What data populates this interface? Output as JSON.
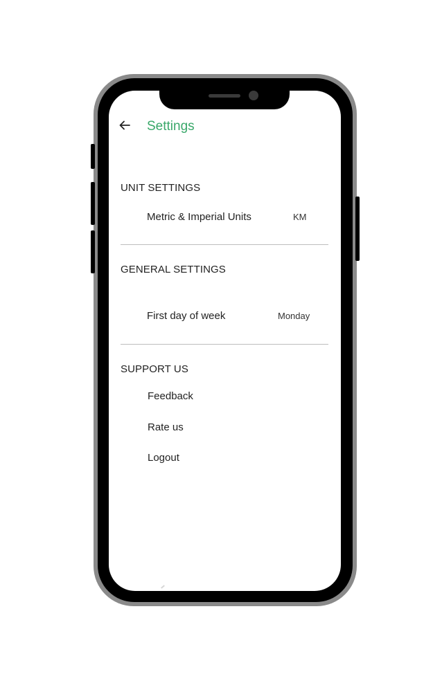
{
  "header": {
    "back_icon": "arrow-left-icon",
    "title": "Settings",
    "title_color": "#3aa86a"
  },
  "sections": {
    "unit": {
      "title": "UNIT SETTINGS",
      "rows": [
        {
          "label": "Metric & Imperial Units",
          "value": "KM"
        }
      ]
    },
    "general": {
      "title": "GENERAL SETTINGS",
      "rows": [
        {
          "label": "First day of week",
          "value": "Monday"
        }
      ]
    },
    "support": {
      "title": "SUPPORT US",
      "items": [
        "Feedback",
        "Rate us",
        "Logout"
      ]
    }
  }
}
